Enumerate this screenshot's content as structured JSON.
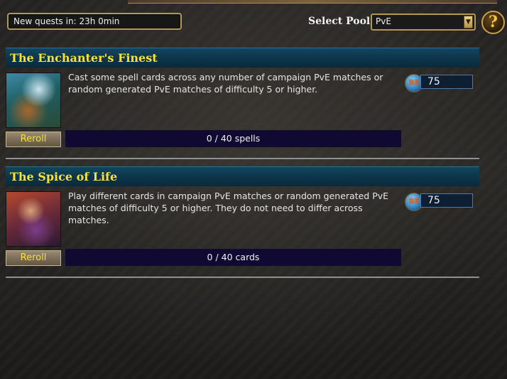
{
  "header": {
    "timer_label": "New quests in:",
    "timer_value": "23h 0min",
    "pool_label": "Select Pool:",
    "pool_value": "PvE",
    "help_symbol": "?"
  },
  "reward_icon_text": "BE",
  "quests": [
    {
      "title": "The Enchanter's Finest",
      "description": "Cast some spell cards across any number of campaign PvE matches or random generated PvE matches of difficulty 5 or higher.",
      "reward": "75",
      "reroll_label": "Reroll",
      "progress": "0 / 40 spells",
      "progress_fraction": 0
    },
    {
      "title": "The Spice of Life",
      "description": "Play different cards in campaign PvE matches or random generated PvE matches of difficulty 5 or higher. They do not need to differ across matches.",
      "reward": "75",
      "reroll_label": "Reroll",
      "progress": "0 / 40 cards",
      "progress_fraction": 0
    }
  ],
  "colors": {
    "title_text": "#f6e23a",
    "title_bar": "#0d3449",
    "progress_bar": "#100a33",
    "frame_gold": "#b49755"
  }
}
